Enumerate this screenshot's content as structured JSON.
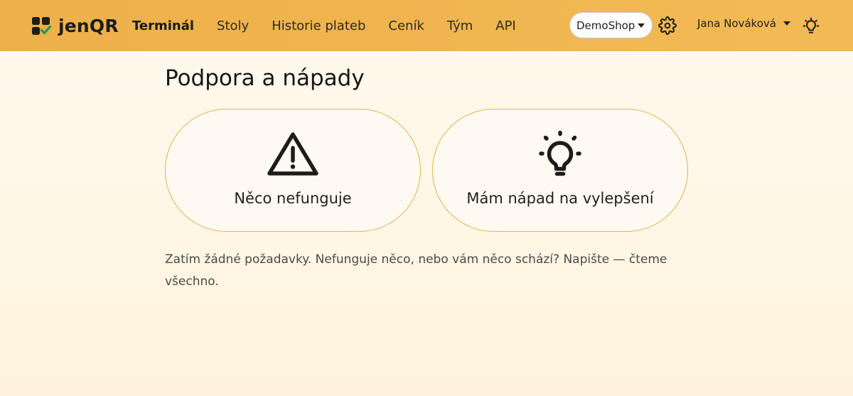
{
  "app": {
    "brand_name": "jenQR"
  },
  "nav": {
    "items": [
      {
        "label": "Terminál",
        "active": true
      },
      {
        "label": "Stoly",
        "active": false
      },
      {
        "label": "Historie plateb",
        "active": false
      },
      {
        "label": "Ceník",
        "active": false
      },
      {
        "label": "Tým",
        "active": false
      },
      {
        "label": "API",
        "active": false
      }
    ]
  },
  "header": {
    "shop_selector": {
      "selected": "DemoShop"
    },
    "settings_icon": "gear-icon",
    "user_name": "Jana Nováková",
    "theme_icon": "lightbulb-icon"
  },
  "page": {
    "title": "Podpora a nápady",
    "cards": [
      {
        "label": "Něco nefunguje",
        "icon": "warning-triangle-icon"
      },
      {
        "label": "Mám nápad na vylepšení",
        "icon": "lightbulb-icon"
      }
    ],
    "empty_message": "Zatím žádné požadavky. Nefunguje něco, nebo vám něco schází? Napište — čteme všechno."
  },
  "colors": {
    "header_bg": "#f0b44e",
    "card_border": "#e2b24d",
    "logo_check": "#1d9a4a",
    "page_bg": "#fff7e6"
  }
}
